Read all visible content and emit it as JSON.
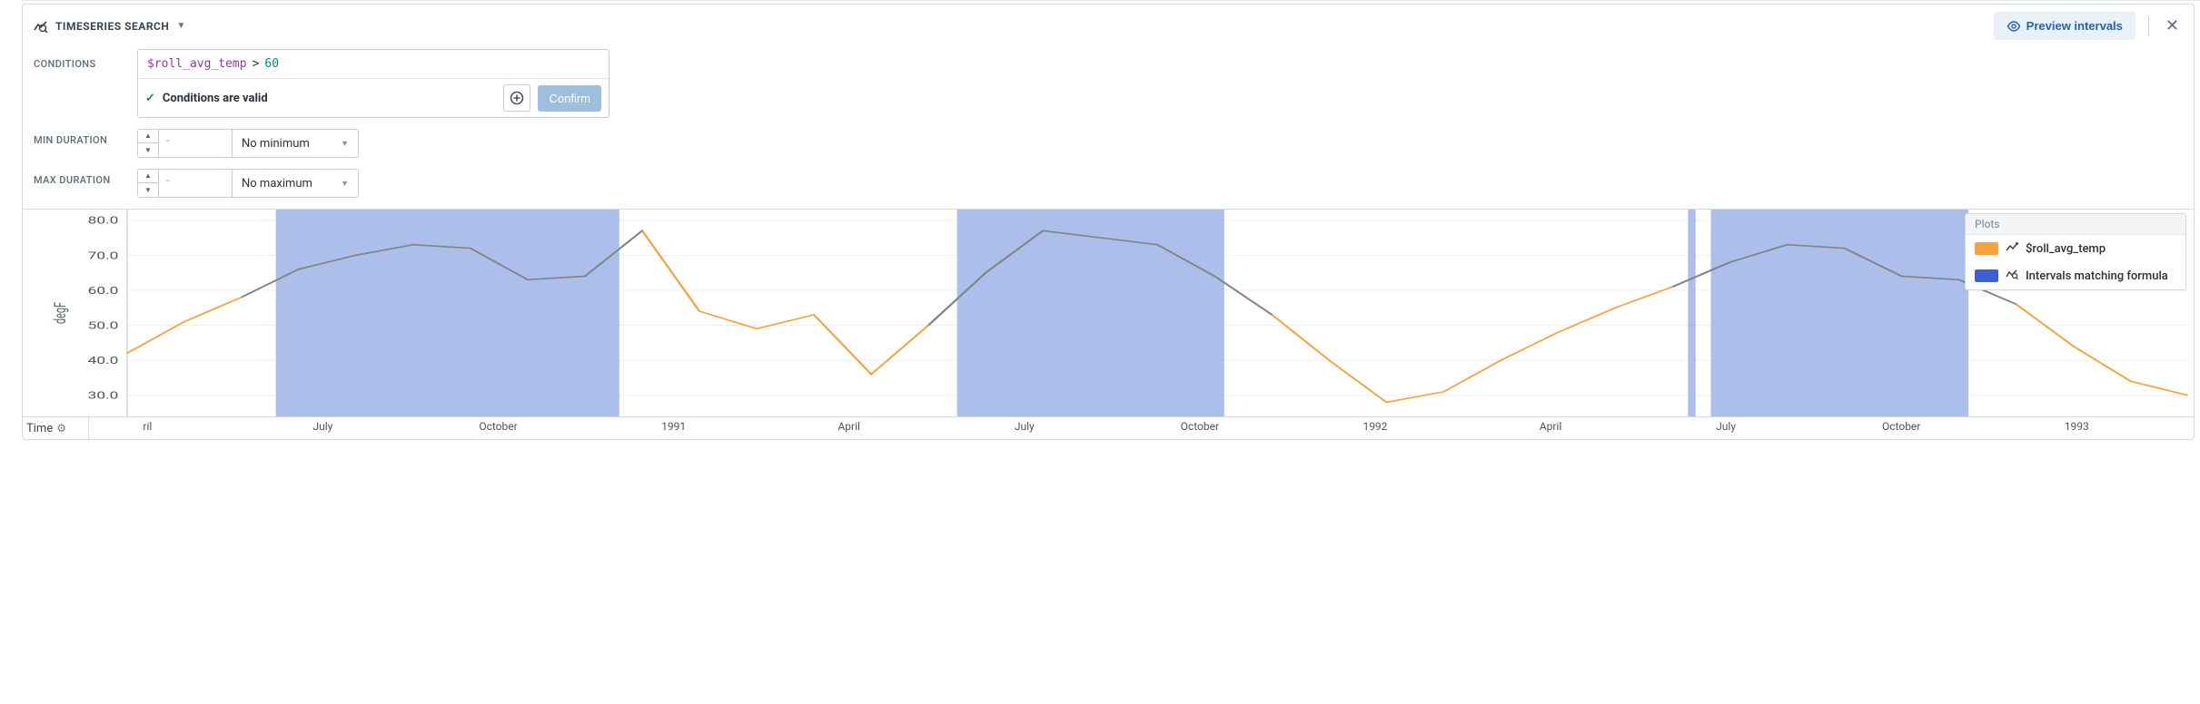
{
  "header": {
    "title": "TIMESERIES SEARCH",
    "preview_button": "Preview intervals"
  },
  "conditions": {
    "label": "CONDITIONS",
    "expr_var": "$roll_avg_temp",
    "expr_op": ">",
    "expr_num": "60",
    "status": "Conditions are valid",
    "confirm": "Confirm"
  },
  "min_dur": {
    "label": "MIN DURATION",
    "value": "-",
    "select": "No minimum"
  },
  "max_dur": {
    "label": "MAX DURATION",
    "value": "-",
    "select": "No maximum"
  },
  "legend": {
    "title": "Plots",
    "series1": "$roll_avg_temp",
    "series2": "Intervals matching formula"
  },
  "yaxis": {
    "label": "degF",
    "ticks": [
      "30.0",
      "40.0",
      "50.0",
      "60.0",
      "70.0",
      "80.0"
    ]
  },
  "xaxis": {
    "label": "Time",
    "ticks": [
      "ril",
      "July",
      "October",
      "1991",
      "April",
      "July",
      "October",
      "1992",
      "April",
      "July",
      "October",
      "1993"
    ]
  },
  "chart_data": {
    "type": "line",
    "xlabel": "Time",
    "ylabel": "degF",
    "ylim": [
      25,
      82
    ],
    "x_ticks": [
      "1990-04",
      "1990-07",
      "1990-10",
      "1991-01",
      "1991-04",
      "1991-07",
      "1991-10",
      "1992-01",
      "1992-04",
      "1992-07",
      "1992-10",
      "1993-01"
    ],
    "series": [
      {
        "name": "$roll_avg_temp",
        "color": "#f5a342",
        "x": [
          "1990-03",
          "1990-04",
          "1990-05",
          "1990-06",
          "1990-07",
          "1990-08",
          "1990-09",
          "1990-10",
          "1990-11",
          "1990-12",
          "1991-01",
          "1991-02",
          "1991-03",
          "1991-04",
          "1991-05",
          "1991-06",
          "1991-07",
          "1991-08",
          "1991-09",
          "1991-10",
          "1991-11",
          "1991-12",
          "1992-01",
          "1992-02",
          "1992-03",
          "1992-04",
          "1992-05",
          "1992-06",
          "1992-07",
          "1992-08",
          "1992-09",
          "1992-10",
          "1992-11",
          "1992-12",
          "1993-01",
          "1993-02",
          "1993-03"
        ],
        "y": [
          42,
          51,
          58,
          66,
          70,
          73,
          72,
          63,
          64,
          77,
          54,
          49,
          53,
          36,
          50,
          65,
          77,
          75,
          73,
          64,
          53,
          40,
          28,
          31,
          40,
          48,
          55,
          61,
          68,
          73,
          72,
          64,
          63,
          56,
          44,
          34,
          30
        ]
      }
    ],
    "intervals": [
      {
        "start": "1990-05-18",
        "end": "1990-11-18"
      },
      {
        "start": "1991-05-15",
        "end": "1991-10-05"
      },
      {
        "start": "1992-06-08",
        "end": "1992-06-12"
      },
      {
        "start": "1992-06-20",
        "end": "1992-11-05"
      }
    ]
  }
}
